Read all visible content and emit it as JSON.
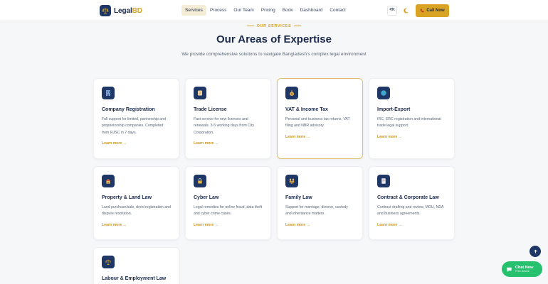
{
  "nav": {
    "brand_main": "Legal",
    "brand_accent": "BD",
    "items": [
      {
        "label": "Services",
        "active": true
      },
      {
        "label": "Process"
      },
      {
        "label": "Our Team"
      },
      {
        "label": "Pricing"
      },
      {
        "label": "Book"
      },
      {
        "label": "Dashboard"
      },
      {
        "label": "Contact"
      }
    ],
    "lang_label": "বাং",
    "call_label": "Call Now"
  },
  "section": {
    "eyebrow": "OUR SERVICES",
    "title": "Our Areas of Expertise",
    "subtitle": "We provide comprehensive solutions to navigate Bangladesh's complex legal environment"
  },
  "services": [
    {
      "title": "Company Registration",
      "desc": "Full support for limited, partnership and proprietorship companies. Completed from RJSC in 7 days.",
      "link": "Learn more →",
      "icon": "building-icon"
    },
    {
      "title": "Trade License",
      "desc": "Fast service for new licenses and renewals. 3-5 working days from City Corporation.",
      "link": "Learn more →",
      "icon": "scroll-icon"
    },
    {
      "title": "VAT & Income Tax",
      "desc": "Personal and business tax returns, VAT filing and NBR advisory.",
      "link": "Learn more →",
      "icon": "money-bag-icon"
    },
    {
      "title": "Import-Export",
      "desc": "IRC, ERC registration and international trade legal support.",
      "link": "Learn more →",
      "icon": "globe-icon"
    },
    {
      "title": "Property & Land Law",
      "desc": "Land purchase/sale, deed registration and dispute resolution.",
      "link": "Learn more →",
      "icon": "house-icon"
    },
    {
      "title": "Cyber Law",
      "desc": "Legal remedies for online fraud, data theft and cyber crime cases.",
      "link": "Learn more →",
      "icon": "lock-icon"
    },
    {
      "title": "Family Law",
      "desc": "Support for marriage, divorce, custody and inheritance matters.",
      "link": "Learn more →",
      "icon": "family-icon"
    },
    {
      "title": "Contract & Corporate Law",
      "desc": "Contract drafting and review, MOU, NDA and business agreements.",
      "link": "Learn more →",
      "icon": "document-icon"
    },
    {
      "title": "Labour & Employment Law",
      "desc": "",
      "link": "",
      "icon": "scales-icon"
    }
  ],
  "chat": {
    "title": "Chat Now",
    "subtitle": "Free Advice"
  },
  "colors": {
    "navy": "#1f3766",
    "gold": "#d9a323",
    "green": "#25c16f"
  }
}
